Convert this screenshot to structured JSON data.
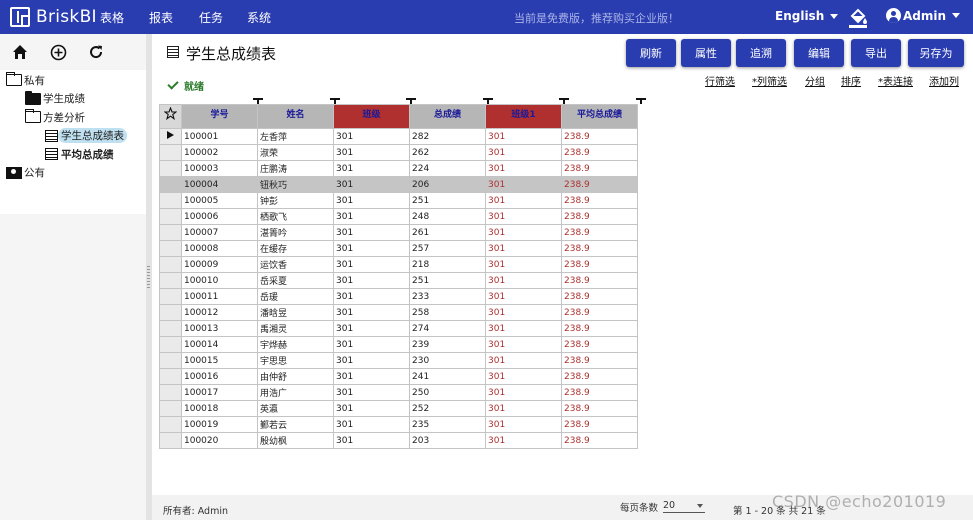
{
  "app": {
    "brand": "BriskBI",
    "nav": [
      "表格",
      "报表",
      "任务",
      "系统"
    ],
    "notice": "当前是免费版，推荐购买企业版！",
    "language": "English",
    "user": "Admin"
  },
  "sidebar": {
    "tools": [
      "home-icon",
      "add-circle-icon",
      "refresh-icon"
    ],
    "tree": [
      {
        "label": "私有",
        "icon": "folder-open-icon"
      },
      {
        "label": "学生成绩",
        "icon": "folder-icon"
      },
      {
        "label": "方差分析",
        "icon": "folder-open-icon"
      },
      {
        "label": "学生总成绩表",
        "icon": "table-icon"
      },
      {
        "label": "平均总成绩",
        "icon": "table-icon"
      },
      {
        "label": "公有",
        "icon": "folder-shared-icon"
      }
    ]
  },
  "main": {
    "title": "学生总成绩表",
    "buttons": [
      "刷新",
      "属性",
      "追溯",
      "编辑",
      "导出",
      "另存为"
    ],
    "status": "就绪",
    "links": [
      "行筛选",
      "*列筛选",
      "分组",
      "排序",
      "*表连接",
      "添加列"
    ]
  },
  "table": {
    "columns": [
      "学号",
      "姓名",
      "班级",
      "总成绩",
      "班级1",
      "平均总成绩"
    ],
    "selected_row": 3,
    "rows": [
      [
        "100001",
        "左香萍",
        "301",
        "282",
        "301",
        "238.9"
      ],
      [
        "100002",
        "淑荣",
        "301",
        "262",
        "301",
        "238.9"
      ],
      [
        "100003",
        "庄鹏涛",
        "301",
        "224",
        "301",
        "238.9"
      ],
      [
        "100004",
        "钮秋巧",
        "301",
        "206",
        "301",
        "238.9"
      ],
      [
        "100005",
        "钟彭",
        "301",
        "251",
        "301",
        "238.9"
      ],
      [
        "100006",
        "栖歌飞",
        "301",
        "248",
        "301",
        "238.9"
      ],
      [
        "100007",
        "湛箐吟",
        "301",
        "261",
        "301",
        "238.9"
      ],
      [
        "100008",
        "在缓存",
        "301",
        "257",
        "301",
        "238.9"
      ],
      [
        "100009",
        "运饮香",
        "301",
        "218",
        "301",
        "238.9"
      ],
      [
        "100010",
        "岳采夏",
        "301",
        "251",
        "301",
        "238.9"
      ],
      [
        "100011",
        "岳瑗",
        "301",
        "233",
        "301",
        "238.9"
      ],
      [
        "100012",
        "潘晗昱",
        "301",
        "258",
        "301",
        "238.9"
      ],
      [
        "100013",
        "禹湘灵",
        "301",
        "274",
        "301",
        "238.9"
      ],
      [
        "100014",
        "宇烨赫",
        "301",
        "239",
        "301",
        "238.9"
      ],
      [
        "100015",
        "宇思思",
        "301",
        "230",
        "301",
        "238.9"
      ],
      [
        "100016",
        "由仲舒",
        "301",
        "241",
        "301",
        "238.9"
      ],
      [
        "100017",
        "用浩广",
        "301",
        "250",
        "301",
        "238.9"
      ],
      [
        "100018",
        "英瀛",
        "301",
        "252",
        "301",
        "238.9"
      ],
      [
        "100019",
        "鄞若云",
        "301",
        "235",
        "301",
        "238.9"
      ],
      [
        "100020",
        "殷幼枫",
        "301",
        "203",
        "301",
        "238.9"
      ]
    ]
  },
  "footer": {
    "owner": "所有者: Admin",
    "per_page_label": "每页条数",
    "per_page": "20",
    "range": "第 1 - 20 条 共 21 条",
    "watermark": "CSDN @echo201019"
  },
  "colors": {
    "topbar": "#2a3db0",
    "header_gray": "#b6b6b6",
    "header_red": "#b03030",
    "status_green": "#2d7d2d"
  }
}
